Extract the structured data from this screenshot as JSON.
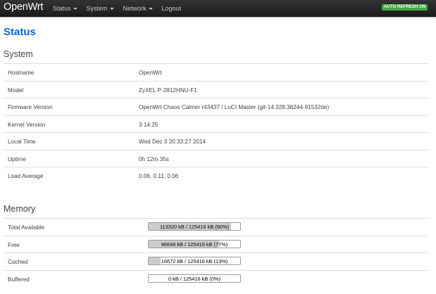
{
  "navbar": {
    "brand": "OpenWrt",
    "menu": [
      "Status",
      "System",
      "Network",
      "Logout"
    ],
    "auto_refresh": "AUTO REFRESH ON",
    "colors": {
      "badge": "#46a546",
      "title": "#0069d6"
    }
  },
  "page_title": "Status",
  "system": {
    "title": "System",
    "rows": [
      {
        "label": "Hostname",
        "value": "OpenWrt"
      },
      {
        "label": "Model",
        "value": "ZyXEL P-2812HNU-F1"
      },
      {
        "label": "Firmware Version",
        "value": "OpenWrt Chaos Calmer r43437 / LuCI Master (git-14.328.38244-91532de)"
      },
      {
        "label": "Kernel Version",
        "value": "3.14.25"
      },
      {
        "label": "Local Time",
        "value": "Wed Dec 3 20:33:27 2014"
      },
      {
        "label": "Uptime",
        "value": "0h 12m 35s"
      },
      {
        "label": "Load Average",
        "value": "0.06, 0.11, 0.06"
      }
    ]
  },
  "memory": {
    "title": "Memory",
    "rows": [
      {
        "label": "Total Available",
        "text": "113320 kB / 125416 kB (90%)",
        "percent": 90
      },
      {
        "label": "Free",
        "text": "96648 kB / 125416 kB (77%)",
        "percent": 77
      },
      {
        "label": "Cached",
        "text": "16672 kB / 125416 kB (13%)",
        "percent": 13
      },
      {
        "label": "Buffered",
        "text": "0 kB / 125416 kB (0%)",
        "percent": 0
      }
    ]
  }
}
